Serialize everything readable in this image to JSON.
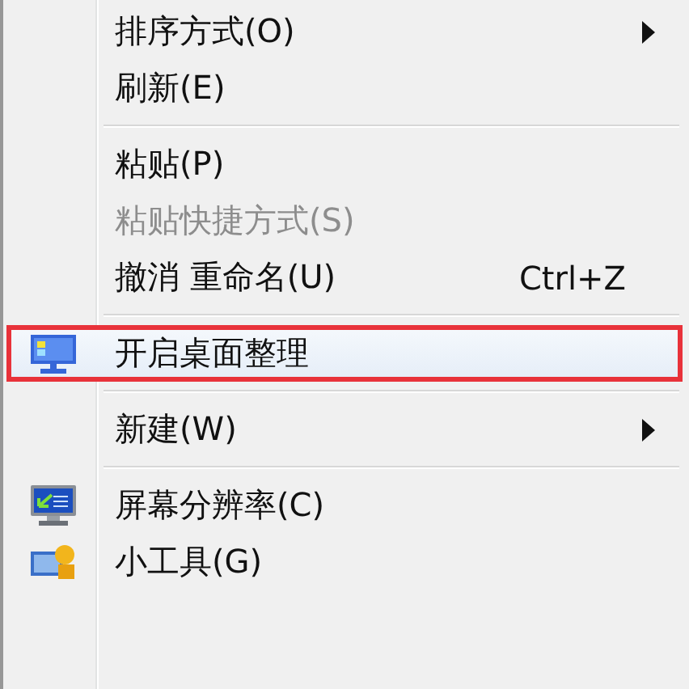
{
  "menu": {
    "items": [
      {
        "kind": "item",
        "label": "排序方式(O)",
        "submenu": true,
        "disabled": false,
        "selected": false
      },
      {
        "kind": "item",
        "label": "刷新(E)",
        "submenu": false,
        "disabled": false,
        "selected": false
      },
      {
        "kind": "separator"
      },
      {
        "kind": "item",
        "label": "粘贴(P)",
        "submenu": false,
        "disabled": false,
        "selected": false
      },
      {
        "kind": "item",
        "label": "粘贴快捷方式(S)",
        "submenu": false,
        "disabled": true,
        "selected": false
      },
      {
        "kind": "item",
        "label": "撤消 重命名(U)",
        "shortcut": "Ctrl+Z",
        "submenu": false,
        "disabled": false,
        "selected": false
      },
      {
        "kind": "separator"
      },
      {
        "kind": "icon-item",
        "label": "开启桌面整理",
        "submenu": false,
        "disabled": false,
        "selected": true
      },
      {
        "kind": "separator"
      },
      {
        "kind": "item",
        "label": "新建(W)",
        "submenu": true,
        "disabled": false,
        "selected": false
      },
      {
        "kind": "separator"
      },
      {
        "kind": "icon-item",
        "label": "屏幕分辨率(C)",
        "submenu": false,
        "disabled": false,
        "selected": false
      },
      {
        "kind": "icon-item",
        "label": "小工具(G)",
        "submenu": false,
        "disabled": false,
        "selected": false
      }
    ]
  }
}
